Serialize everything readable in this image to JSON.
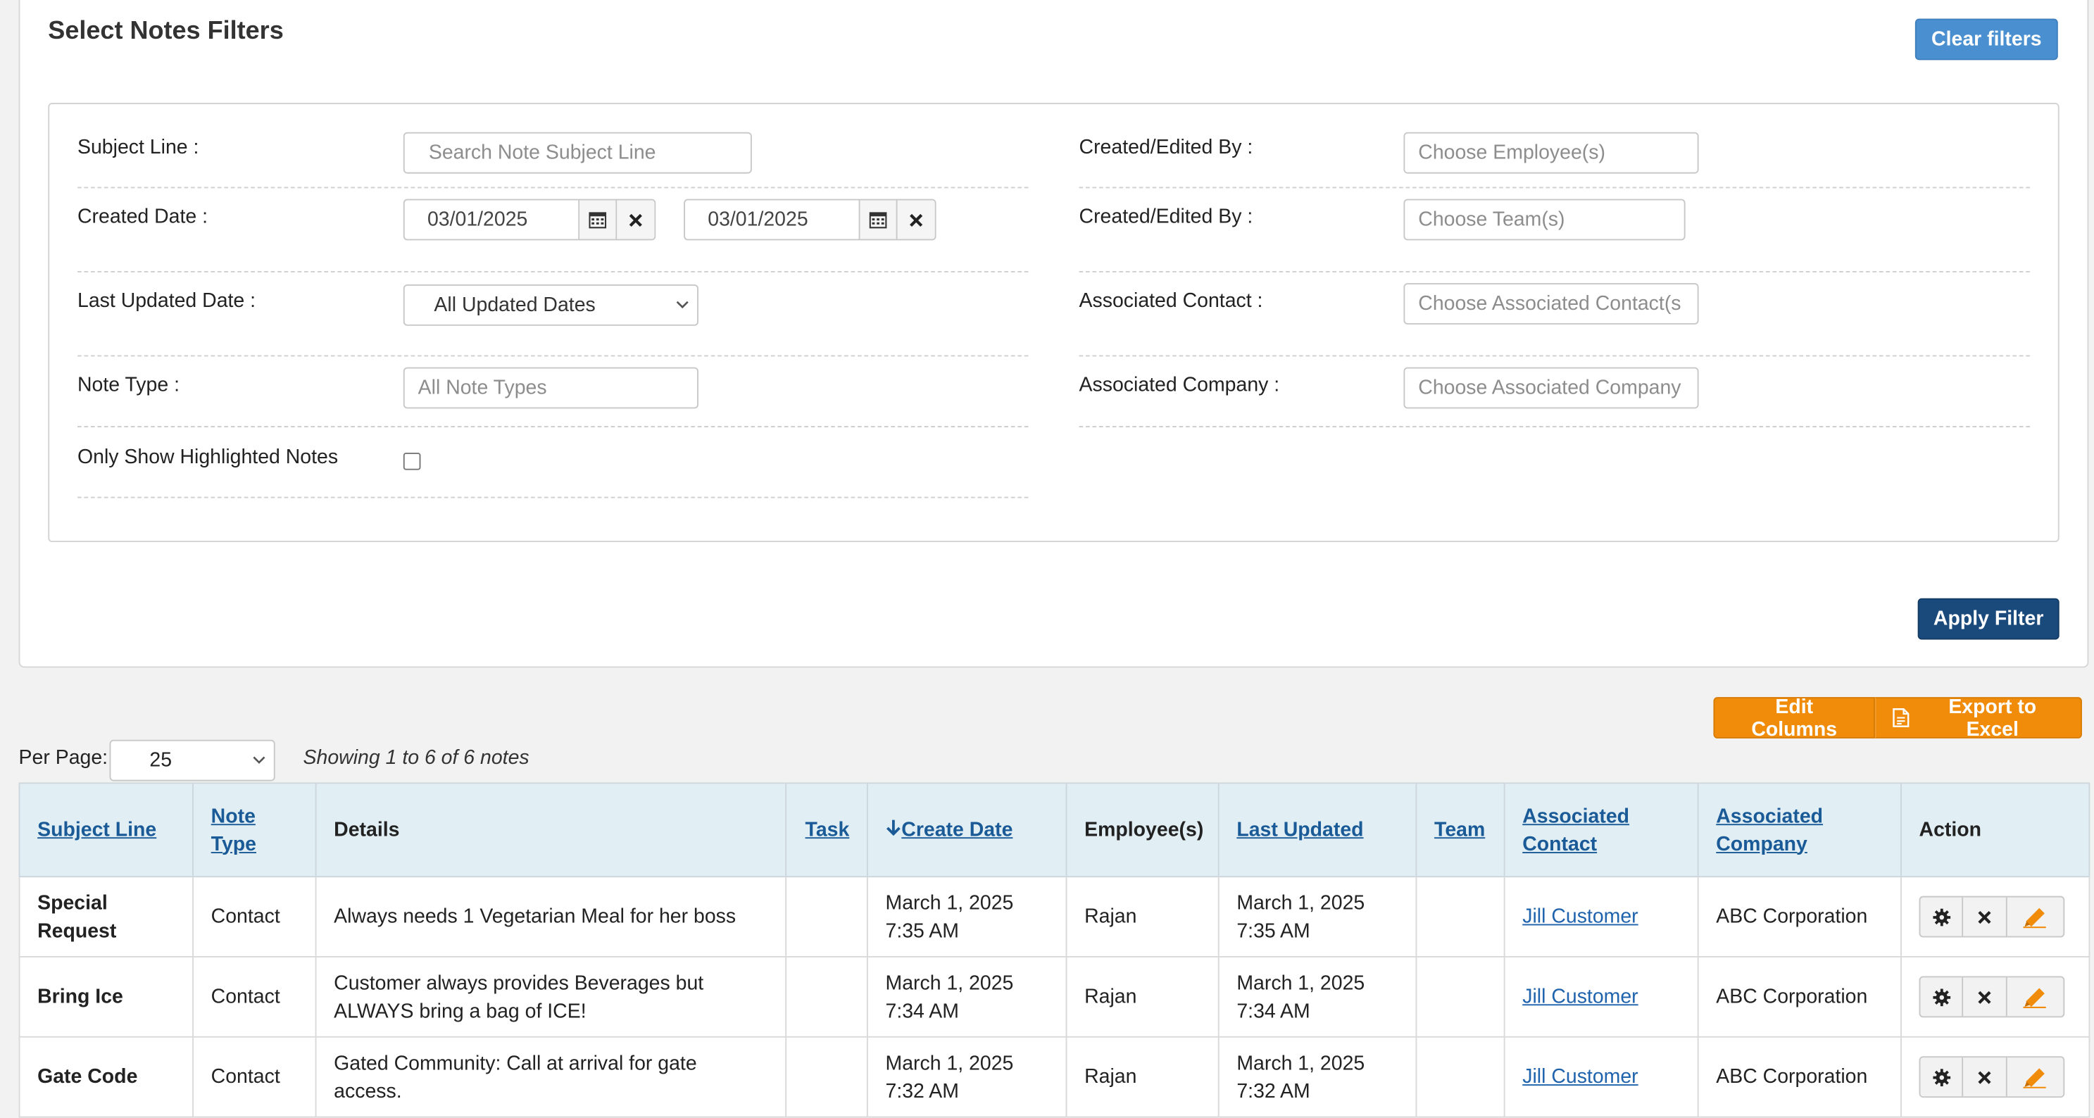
{
  "filters": {
    "title": "Select Notes Filters",
    "clear_label": "Clear filters",
    "apply_label": "Apply Filter",
    "subject_line": {
      "label": "Subject Line :",
      "placeholder": "Search Note Subject Line"
    },
    "created_date": {
      "label": "Created Date :",
      "from": "03/01/2025",
      "to": "03/01/2025"
    },
    "last_updated": {
      "label": "Last Updated Date :",
      "selected": "All Updated Dates"
    },
    "note_type": {
      "label": "Note Type :",
      "placeholder": "All Note Types"
    },
    "highlighted": {
      "label": "Only Show Highlighted Notes",
      "checked": false
    },
    "employee": {
      "label": "Created/Edited By :",
      "placeholder": "Choose Employee(s)"
    },
    "team": {
      "label": "Created/Edited By :",
      "placeholder": "Choose Team(s)"
    },
    "contact": {
      "label": "Associated Contact :",
      "placeholder": "Choose Associated Contact(s"
    },
    "company": {
      "label": "Associated Company :",
      "placeholder": "Choose Associated Company"
    }
  },
  "toolbar": {
    "edit_columns_label": "Edit Columns",
    "export_label": "Export to Excel",
    "per_page_label": "Per Page:",
    "per_page_value": "25",
    "showing_text": "Showing 1 to 6 of 6 notes"
  },
  "table": {
    "headers": {
      "subject": "Subject Line",
      "note_type_1": "Note",
      "note_type_2": "Type",
      "details": "Details",
      "task": "Task",
      "create_date": "Create Date",
      "employees": "Employee(s)",
      "last_updated": "Last Updated",
      "team": "Team",
      "contact_1": "Associated",
      "contact_2": "Contact",
      "company_1": "Associated",
      "company_2": "Company",
      "action": "Action"
    },
    "rows": [
      {
        "subject_1": "Special",
        "subject_2": "Request",
        "type": "Contact",
        "details_1": "Always needs 1 Vegetarian Meal for her boss",
        "details_2": "",
        "task": "",
        "created_1": "March 1, 2025",
        "created_2": "7:35 AM",
        "employee": "Rajan",
        "updated_1": "March 1, 2025",
        "updated_2": "7:35 AM",
        "team": "",
        "contact": "Jill Customer",
        "company": "ABC Corporation"
      },
      {
        "subject_1": "Bring Ice",
        "subject_2": "",
        "type": "Contact",
        "details_1": "Customer always provides Beverages but",
        "details_2": "ALWAYS bring a bag of ICE!",
        "task": "",
        "created_1": "March 1, 2025",
        "created_2": "7:34 AM",
        "employee": "Rajan",
        "updated_1": "March 1, 2025",
        "updated_2": "7:34 AM",
        "team": "",
        "contact": "Jill Customer",
        "company": "ABC Corporation"
      },
      {
        "subject_1": "Gate Code",
        "subject_2": "",
        "type": "Contact",
        "details_1": "Gated Community: Call at arrival for gate access.",
        "details_2": "",
        "task": "",
        "created_1": "March 1, 2025",
        "created_2": "7:32 AM",
        "employee": "Rajan",
        "updated_1": "March 1, 2025",
        "updated_2": "7:32 AM",
        "team": "",
        "contact": "Jill Customer",
        "company": "ABC Corporation"
      }
    ]
  },
  "colors": {
    "accent": "#4a90d0",
    "apply": "#1a4a7c",
    "orange": "#f08c0a",
    "header_bg": "#e1eff5",
    "link": "#1a5a96"
  }
}
